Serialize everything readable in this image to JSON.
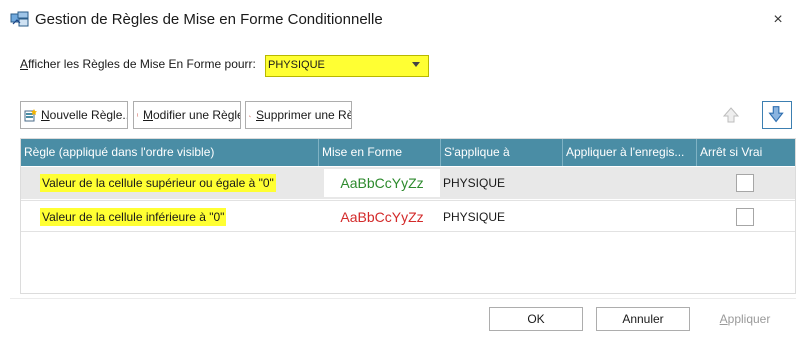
{
  "window": {
    "title": "Gestion de Règles de Mise en Forme Conditionnelle",
    "close_glyph": "×"
  },
  "filter": {
    "label_accel": "A",
    "label_rest": "fficher les Règles de Mise En Forme pourr:",
    "selected_value": "PHYSIQUE",
    "highlight_color": "#ffff33"
  },
  "toolbar": {
    "new_accel": "N",
    "new_rest": "ouvelle Règle...",
    "edit_accel": "M",
    "edit_rest": "odifier une Règle",
    "delete_accel": "S",
    "delete_rest": "upprimer une Rè",
    "move_up_icon": "arrow-up-icon",
    "move_down_icon": "arrow-down-icon"
  },
  "grid": {
    "columns": [
      "Règle (appliqué dans l'ordre visible)",
      "Mise en Forme",
      "S'applique à",
      "Appliquer à l'enregis...",
      "Arrêt si Vrai"
    ],
    "header_color": "#4a8da5",
    "rows": [
      {
        "rule": "Valeur de la cellule supérieur ou égale à \"0\"",
        "preview": "AaBbCcYyZz",
        "preview_color": "#2d8a2d",
        "applies_to": "PHYSIQUE",
        "stop_if_true": false
      },
      {
        "rule": "Valeur de la cellule inférieure à \"0\"",
        "preview": "AaBbCcYyZz",
        "preview_color": "#d32a2a",
        "applies_to": "PHYSIQUE",
        "stop_if_true": false
      }
    ]
  },
  "buttons": {
    "ok": "OK",
    "cancel": "Annuler",
    "apply_accel": "A",
    "apply_rest": "ppliquer"
  }
}
